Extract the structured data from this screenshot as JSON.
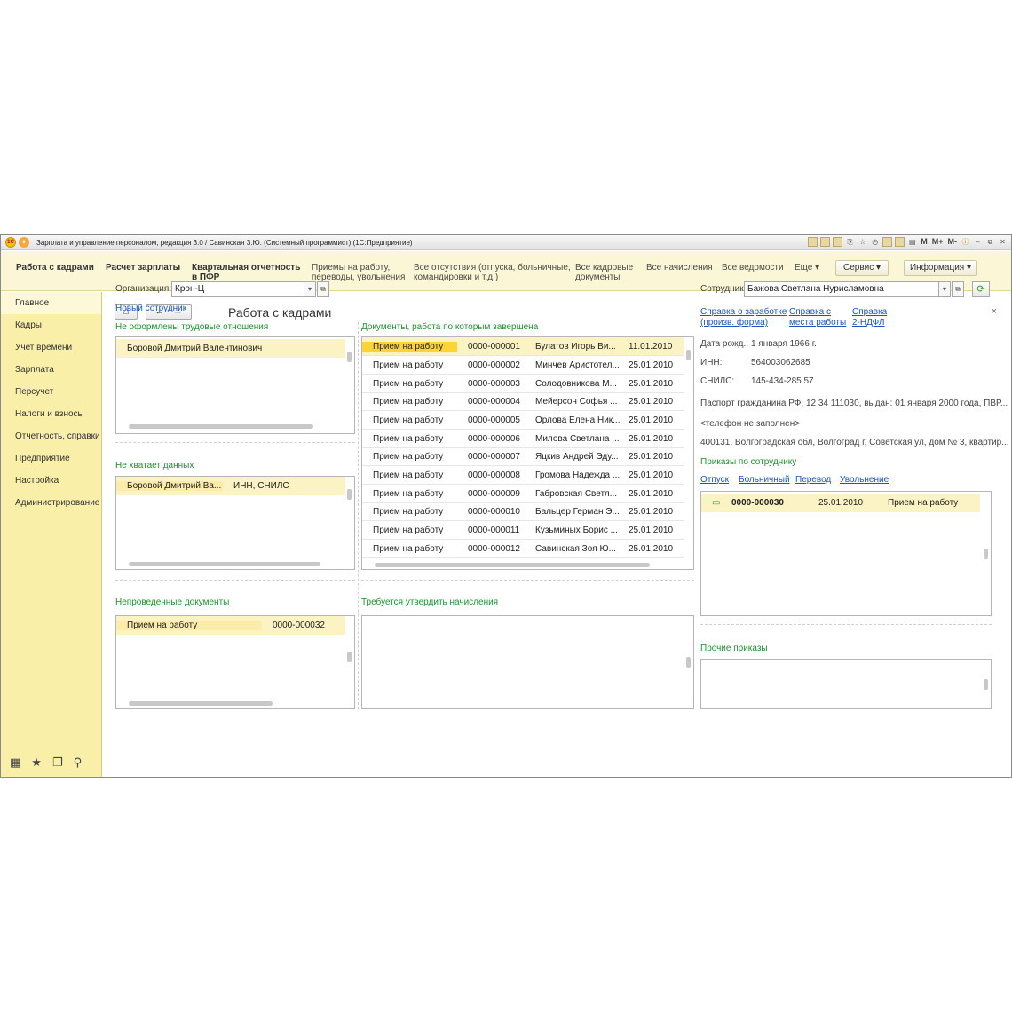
{
  "window": {
    "title": "Зарплата и управление персоналом, редакция 3.0 / Савинская З.Ю. (Системный программист)  (1С:Предприятие)",
    "logo": "1С"
  },
  "sections_panel": {
    "items": [
      {
        "label": "Работа с кадрами",
        "bold": true
      },
      {
        "label": "Расчет зарплаты",
        "bold": true
      },
      {
        "label": "Квартальная отчетность\nв ПФР",
        "bold": true
      },
      {
        "label": "Приемы на работу,\nпереводы, увольнения",
        "bold": false
      },
      {
        "label": "Все отсутствия (отпуска, больничные,\nкомандировки и т.д.)",
        "bold": false
      },
      {
        "label": "Все кадровые\nдокументы",
        "bold": false
      },
      {
        "label": "Все начисления",
        "bold": false
      },
      {
        "label": "Все ведомости",
        "bold": false
      },
      {
        "label": "Еще ▾",
        "bold": false
      }
    ],
    "service_btn": "Сервис ▾",
    "info_btn": "Информация ▾"
  },
  "left_nav": {
    "items": [
      "Главное",
      "Кадры",
      "Учет времени",
      "Зарплата",
      "Персучет",
      "Налоги и взносы",
      "Отчетность, справки",
      "Предприятие",
      "Настройка",
      "Администрирование"
    ],
    "active_index": 0
  },
  "main": {
    "title": "Работа с кадрами",
    "organization_label": "Организация:",
    "organization_value": "Крон-Ц",
    "new_employee_link": "Новый сотрудник",
    "not_formalized": {
      "heading": "Не оформлены трудовые отношения",
      "rows": [
        "Боровой Дмитрий Валентинович"
      ]
    },
    "missing_data": {
      "heading": "Не хватает данных",
      "rows": [
        {
          "name": "Боровой Дмитрий Ва...",
          "missing": "ИНН, СНИЛС"
        }
      ]
    },
    "unposted": {
      "heading": "Непроведенные документы",
      "rows": [
        {
          "doc": "Прием на работу",
          "number": "0000-000032"
        }
      ]
    },
    "completed_docs": {
      "heading": "Документы, работа по которым завершена",
      "rows": [
        {
          "doc": "Прием на работу",
          "number": "0000-000001",
          "employee": "Булатов Игорь Ви...",
          "date": "11.01.2010"
        },
        {
          "doc": "Прием на работу",
          "number": "0000-000002",
          "employee": "Минчев Аристотел...",
          "date": "25.01.2010"
        },
        {
          "doc": "Прием на работу",
          "number": "0000-000003",
          "employee": "Солодовникова М...",
          "date": "25.01.2010"
        },
        {
          "doc": "Прием на работу",
          "number": "0000-000004",
          "employee": "Мейерсон Софья ...",
          "date": "25.01.2010"
        },
        {
          "doc": "Прием на работу",
          "number": "0000-000005",
          "employee": "Орлова Елена Ник...",
          "date": "25.01.2010"
        },
        {
          "doc": "Прием на работу",
          "number": "0000-000006",
          "employee": "Милова Светлана ...",
          "date": "25.01.2010"
        },
        {
          "doc": "Прием на работу",
          "number": "0000-000007",
          "employee": "Яцкив Андрей Эду...",
          "date": "25.01.2010"
        },
        {
          "doc": "Прием на работу",
          "number": "0000-000008",
          "employee": "Громова Надежда ...",
          "date": "25.01.2010"
        },
        {
          "doc": "Прием на работу",
          "number": "0000-000009",
          "employee": "Габровская Светл...",
          "date": "25.01.2010"
        },
        {
          "doc": "Прием на работу",
          "number": "0000-000010",
          "employee": "Бальцер Герман Э...",
          "date": "25.01.2010"
        },
        {
          "doc": "Прием на работу",
          "number": "0000-000011",
          "employee": "Кузьминых Борис ...",
          "date": "25.01.2010"
        },
        {
          "doc": "Прием на работу",
          "number": "0000-000012",
          "employee": "Савинская Зоя Ю...",
          "date": "25.01.2010"
        }
      ]
    },
    "approve_accruals": {
      "heading": "Требуется утвердить начисления"
    },
    "employee_panel": {
      "label": "Сотрудник:",
      "value": "Бажова Светлана Нурисламовна",
      "links": [
        {
          "text": "Справка о заработке\n(произв. форма)"
        },
        {
          "text": "Справка с\nместа работы"
        },
        {
          "text": "Справка\n2-НДФЛ"
        }
      ],
      "birth_label": "Дата рожд.:",
      "birth_value": "1 января 1966 г.",
      "inn_label": "ИНН:",
      "inn_value": "564003062685",
      "snils_label": "СНИЛС:",
      "snils_value": "145-434-285 57",
      "passport": "Паспорт гражданина РФ,  12 34 111030, выдан: 01 января 2000 года, ПВР...",
      "phone": "<телефон не заполнен>",
      "address": "400131, Волгоградская обл, Волгоград г, Советская ул, дом № 3, квартир...",
      "orders_heading": "Приказы по сотруднику",
      "order_links": [
        "Отпуск",
        "Больничный",
        "Перевод",
        "Увольнение"
      ],
      "orders": [
        {
          "number": "0000-000030",
          "date": "25.01.2010",
          "type": "Прием на работу"
        }
      ],
      "other_orders_heading": "Прочие приказы"
    }
  }
}
